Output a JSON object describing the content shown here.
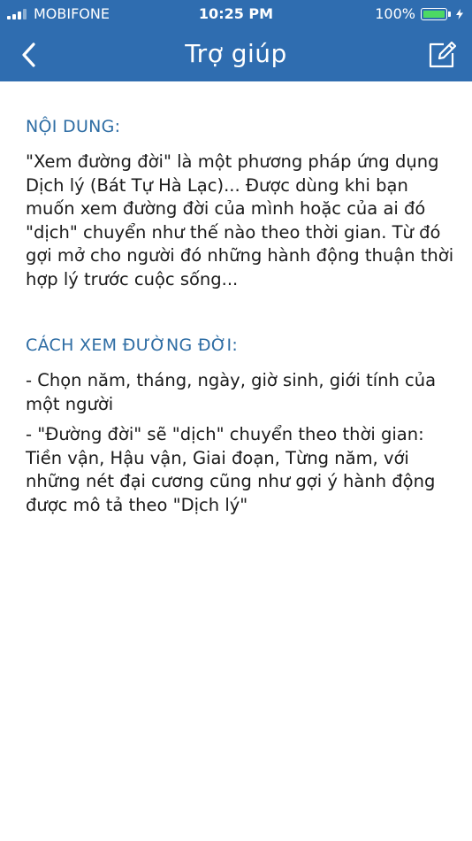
{
  "status_bar": {
    "carrier": "MOBIFONE",
    "time": "10:25 PM",
    "battery_percent": "100%",
    "battery_level": 1.0,
    "colors": {
      "background": "#2f6db0",
      "battery_fill": "#4cd964"
    }
  },
  "navbar": {
    "title": "Trợ giúp",
    "back_icon": "chevron-left-icon",
    "edit_icon": "compose-icon"
  },
  "content": {
    "sections": [
      {
        "heading": "NỘI DUNG:",
        "paragraphs": [
          "\"Xem đường đời\" là một phương pháp ứng dụng Dịch lý (Bát Tự Hà Lạc)... Được dùng khi bạn muốn xem đường đời của mình hoặc của ai đó \"dịch\" chuyển như thế nào theo thời gian. Từ đó gợi mở cho người đó những hành động thuận thời hợp lý trước cuộc sống..."
        ]
      },
      {
        "heading": "CÁCH XEM ĐƯỜNG ĐỜI:",
        "paragraphs": [
          "- Chọn năm, tháng, ngày, giờ sinh, giới tính của một người",
          "- \"Đường đời\" sẽ \"dịch\" chuyển theo thời gian: Tiền vận, Hậu vận, Giai đoạn, Từng năm, với những nét đại cương cũng như gợi ý hành động được mô tả theo \"Dịch lý\""
        ]
      }
    ],
    "colors": {
      "heading": "#2e6da4",
      "body_text": "#1a1a1a"
    }
  }
}
